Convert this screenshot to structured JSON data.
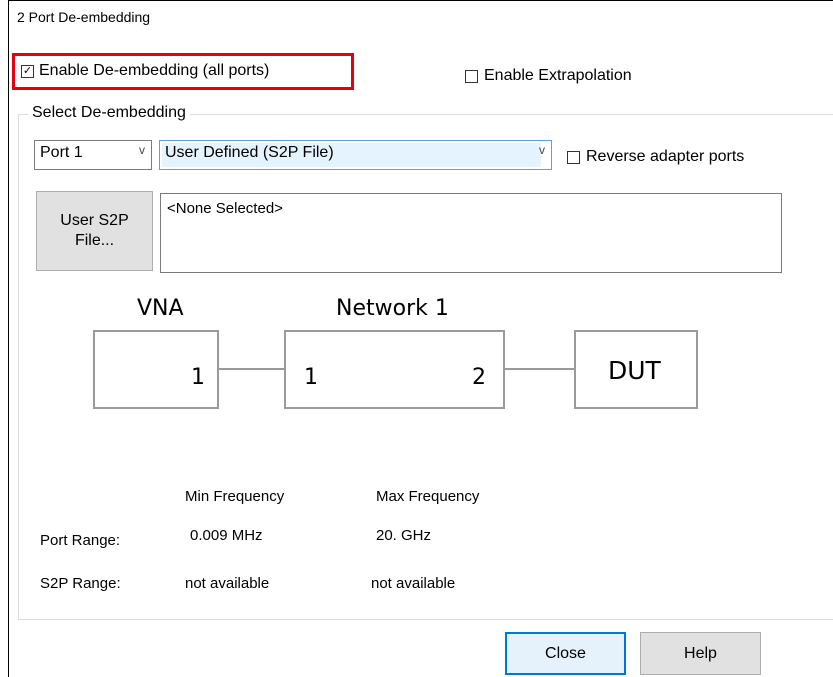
{
  "window": {
    "title": "2 Port De-embedding"
  },
  "options": {
    "enable_deembedding": {
      "label": "Enable De-embedding (all ports)",
      "checked": true,
      "check_glyph": "✓"
    },
    "enable_extrapolation": {
      "label": "Enable Extrapolation",
      "checked": false
    }
  },
  "select_group": {
    "title": "Select De-embedding",
    "port_combo": {
      "value": "Port 1",
      "arrow": "v"
    },
    "type_combo": {
      "value": "User Defined (S2P File)",
      "arrow": "v"
    },
    "reverse_ports": {
      "label": "Reverse adapter ports",
      "checked": false
    },
    "user_file_button": {
      "line1": "User S2P",
      "line2": "File..."
    },
    "file_display": {
      "value": "<None Selected>"
    }
  },
  "diagram": {
    "vna_label": "VNA",
    "network_label": "Network 1",
    "vna_port": "1",
    "net_port_left": "1",
    "net_port_right": "2",
    "dut_label": "DUT"
  },
  "ranges": {
    "min_header": "Min Frequency",
    "max_header": "Max Frequency",
    "port_range_label": "Port Range:",
    "port_min": "0.009 MHz",
    "port_max": "20. GHz",
    "s2p_range_label": "S2P Range:",
    "s2p_min": "not available",
    "s2p_max": "not available"
  },
  "buttons": {
    "close": "Close",
    "help": "Help"
  },
  "colors": {
    "highlight_red": "#e3000f",
    "combo_highlight": "#e5f3ff",
    "default_button": "#0078d7"
  }
}
